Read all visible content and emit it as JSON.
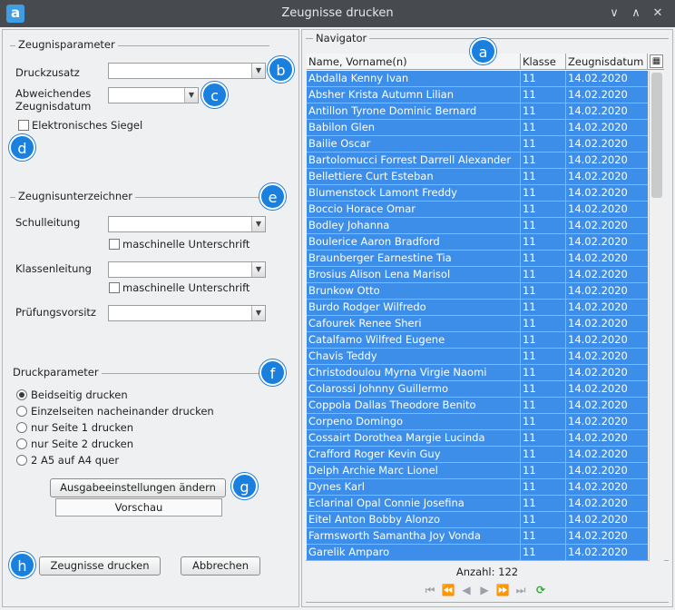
{
  "window": {
    "title": "Zeugnisse drucken",
    "app_icon": "a",
    "controls": [
      "chevron-down-icon",
      "chevron-up-icon",
      "close-icon"
    ]
  },
  "zeugnisparameter": {
    "legend": "Zeugnisparameter",
    "druckzusatz_label": "Druckzusatz",
    "druckzusatz_value": "",
    "abweichendes_label_1": "Abweichendes",
    "abweichendes_label_2": "Zeugnisdatum",
    "abweichendes_value": "",
    "siegel_label": "Elektronisches Siegel",
    "siegel_checked": false
  },
  "unterzeichner": {
    "legend": "Zeugnisunterzeichner",
    "schulleitung_label": "Schulleitung",
    "schulleitung_value": "",
    "schulleitung_maschinell": "maschinelle Unterschrift",
    "klassenleitung_label": "Klassenleitung",
    "klassenleitung_value": "",
    "klassenleitung_maschinell": "maschinelle Unterschrift",
    "pruefungsvorsitz_label": "Prüfungsvorsitz",
    "pruefungsvorsitz_value": ""
  },
  "druckparameter": {
    "legend": "Druckparameter",
    "options": [
      "Beidseitig drucken",
      "Einzelseiten nacheinander drucken",
      "nur Seite 1 drucken",
      "nur Seite 2 drucken",
      "2 A5 auf A4 quer"
    ],
    "selected": 0,
    "ausgabe_button": "Ausgabeeinstellungen ändern",
    "vorschau_label": "Vorschau"
  },
  "footer": {
    "print_button": "Zeugnisse drucken",
    "cancel_button": "Abbrechen"
  },
  "navigator": {
    "legend": "Navigator",
    "columns": [
      "Name, Vorname(n)",
      "Klasse",
      "Zeugnisdatum"
    ],
    "rows": [
      [
        "Abdalla Kenny Ivan",
        "11",
        "14.02.2020"
      ],
      [
        "Absher Krista Autumn Lilian",
        "11",
        "14.02.2020"
      ],
      [
        "Antillon Tyrone Dominic Bernard",
        "11",
        "14.02.2020"
      ],
      [
        "Babilon Glen",
        "11",
        "14.02.2020"
      ],
      [
        "Bailie Oscar",
        "11",
        "14.02.2020"
      ],
      [
        "Bartolomucci Forrest Darrell Alexander",
        "11",
        "14.02.2020"
      ],
      [
        "Bellettiere Curt Esteban",
        "11",
        "14.02.2020"
      ],
      [
        "Blumenstock Lamont Freddy",
        "11",
        "14.02.2020"
      ],
      [
        "Boccio Horace Omar",
        "11",
        "14.02.2020"
      ],
      [
        "Bodley Johanna",
        "11",
        "14.02.2020"
      ],
      [
        "Boulerice Aaron Bradford",
        "11",
        "14.02.2020"
      ],
      [
        "Braunberger Earnestine Tia",
        "11",
        "14.02.2020"
      ],
      [
        "Brosius Alison Lena Marisol",
        "11",
        "14.02.2020"
      ],
      [
        "Brunkow Otto",
        "11",
        "14.02.2020"
      ],
      [
        "Burdo Rodger Wilfredo",
        "11",
        "14.02.2020"
      ],
      [
        "Cafourek Renee Sheri",
        "11",
        "14.02.2020"
      ],
      [
        "Catalfamo Wilfred Eugene",
        "11",
        "14.02.2020"
      ],
      [
        "Chavis Teddy",
        "11",
        "14.02.2020"
      ],
      [
        "Christodoulou Myrna Virgie Naomi",
        "11",
        "14.02.2020"
      ],
      [
        "Colarossi Johnny Guillermo",
        "11",
        "14.02.2020"
      ],
      [
        "Coppola Dallas Theodore Benito",
        "11",
        "14.02.2020"
      ],
      [
        "Corpeno Domingo",
        "11",
        "14.02.2020"
      ],
      [
        "Cossairt Dorothea Margie Lucinda",
        "11",
        "14.02.2020"
      ],
      [
        "Crafford Roger Kevin Guy",
        "11",
        "14.02.2020"
      ],
      [
        "Delph Archie Marc Lionel",
        "11",
        "14.02.2020"
      ],
      [
        "Dynes Karl",
        "11",
        "14.02.2020"
      ],
      [
        "Eclarinal Opal Connie Josefina",
        "11",
        "14.02.2020"
      ],
      [
        "Eitel Anton Bobby Alonzo",
        "11",
        "14.02.2020"
      ],
      [
        "Farmsworth Samantha Joy Vonda",
        "11",
        "14.02.2020"
      ],
      [
        "Garelik Amparo",
        "11",
        "14.02.2020"
      ]
    ],
    "count_label": "Anzahl: 122"
  },
  "badges": {
    "a": "a",
    "b": "b",
    "c": "c",
    "d": "d",
    "e": "e",
    "f": "f",
    "g": "g",
    "h": "h"
  },
  "colors": {
    "selection": "#3d8ee8",
    "badge": "#1a80e0",
    "titlebar": "#474a4f"
  }
}
